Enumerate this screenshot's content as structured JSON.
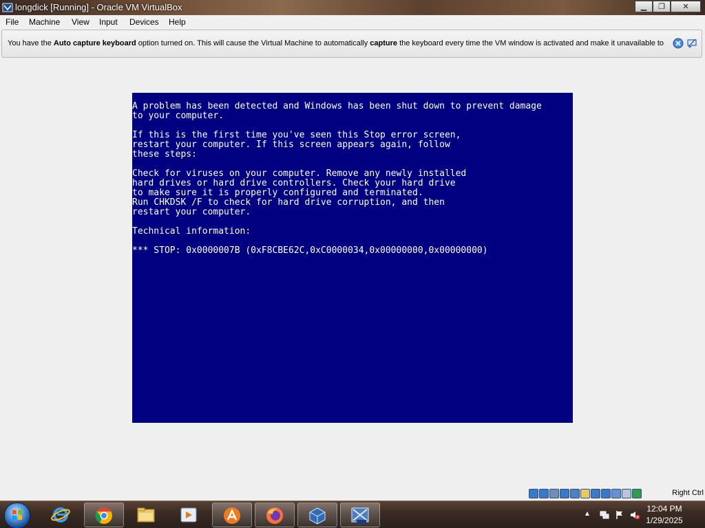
{
  "window": {
    "title": "longdick [Running] - Oracle VM VirtualBox",
    "minimize_label": "▁",
    "maximize_label": "❐",
    "close_label": "✕"
  },
  "menu": {
    "items": [
      "File",
      "Machine",
      "View",
      "Input",
      "Devices",
      "Help"
    ]
  },
  "notice": {
    "part1": "You have the ",
    "bold1": "Auto capture keyboard",
    "part2": " option turned on. This will cause the Virtual Machine to automatically ",
    "bold2": "capture",
    "part3": " the keyboard every time the VM window is activated and make it unavailable to"
  },
  "bsod": {
    "lines": [
      "A problem has been detected and Windows has been shut down to prevent damage",
      "to your computer.",
      "",
      "If this is the first time you've seen this Stop error screen,",
      "restart your computer. If this screen appears again, follow",
      "these steps:",
      "",
      "Check for viruses on your computer. Remove any newly installed",
      "hard drives or hard drive controllers. Check your hard drive",
      "to make sure it is properly configured and terminated.",
      "Run CHKDSK /F to check for hard drive corruption, and then",
      "restart your computer.",
      "",
      "Technical information:",
      "",
      "*** STOP: 0x0000007B (0xF8CBE62C,0xC0000034,0x00000000,0x00000000)"
    ],
    "background": "#000080"
  },
  "statusbar": {
    "host_key": "Right Ctrl",
    "icons": [
      "hard-disk-icon",
      "optical-drive-icon",
      "audio-icon",
      "network-icon",
      "usb-icon",
      "shared-folders-icon",
      "display-icon",
      "video-capture-icon",
      "virtualization-icon",
      "mouse-integration-icon",
      "arrow-icon"
    ]
  },
  "taskbar": {
    "apps": [
      "internet-explorer-icon",
      "chrome-icon",
      "file-explorer-icon",
      "media-player-icon",
      "avast-icon",
      "firefox-icon",
      "virtualbox-icon",
      "vista-vm-icon"
    ],
    "time": "12:04 PM",
    "date": "1/29/2025"
  }
}
